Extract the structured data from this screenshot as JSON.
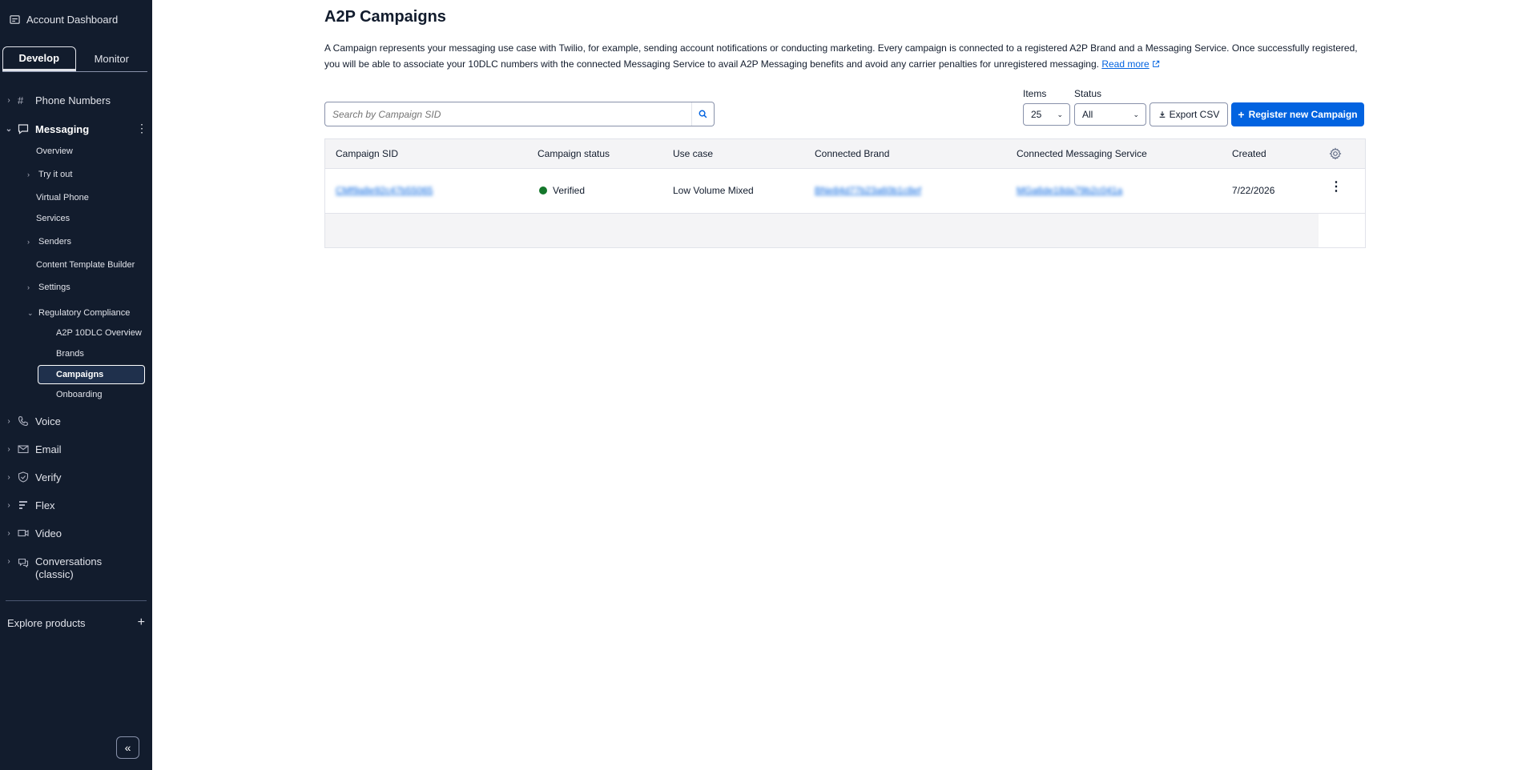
{
  "sidebar": {
    "account": "Account Dashboard",
    "tabs": [
      {
        "label": "Develop",
        "active": true
      },
      {
        "label": "Monitor",
        "active": false
      }
    ],
    "products": {
      "phone_numbers": "Phone Numbers",
      "messaging": "Messaging",
      "voice": "Voice",
      "email": "Email",
      "verify": "Verify",
      "flex": "Flex",
      "video": "Video",
      "conversations": "Conversations (classic)"
    },
    "messaging_items": {
      "overview": "Overview",
      "try_it_out": "Try it out",
      "virtual_phone": "Virtual Phone",
      "services": "Services",
      "senders": "Senders",
      "content_template_builder": "Content Template Builder",
      "settings": "Settings",
      "regulatory_compliance": "Regulatory Compliance"
    },
    "compliance_items": {
      "a2p_overview": "A2P 10DLC Overview",
      "brands": "Brands",
      "campaigns": "Campaigns",
      "onboarding": "Onboarding"
    },
    "explore": "Explore products",
    "explore_plus": "+",
    "collapse": "«"
  },
  "main": {
    "title": "A2P Campaigns",
    "description": "A Campaign represents your messaging use case with Twilio, for example, sending account notifications or conducting marketing. Every campaign is connected to a registered A2P Brand and a Messaging Service. Once successfully registered, you will be able to associate your 10DLC numbers with the connected Messaging Service to avail A2P Messaging benefits and avoid any carrier penalties for unregistered messaging.",
    "read_more": "Read more",
    "search_placeholder": "Search by Campaign SID",
    "items_label": "Items",
    "items_value": "25",
    "status_label": "Status",
    "status_value": "All",
    "export_label": "Export CSV",
    "register_label": "Register new Campaign"
  },
  "table": {
    "headers": {
      "sid": "Campaign SID",
      "status": "Campaign status",
      "use_case": "Use case",
      "brand": "Connected Brand",
      "service": "Connected Messaging Service",
      "created": "Created"
    },
    "rows": [
      {
        "sid": "CMf9a8e92c47b55065",
        "status": "Verified",
        "use_case": "Low Volume Mixed",
        "brand": "BNe84d77b23a60b1c8ef",
        "service": "MGa6de18da79b2c041a",
        "created": "7/22/2026"
      }
    ]
  },
  "colors": {
    "sidebar_bg": "#121c2d",
    "primary_blue": "#0263e0",
    "verified_green": "#14772b"
  }
}
